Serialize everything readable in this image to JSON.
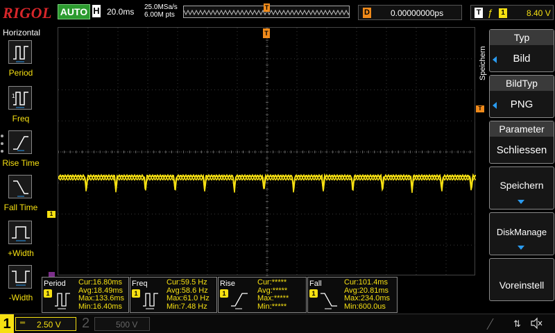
{
  "top": {
    "logo": "RIGOL",
    "auto_label": "AUTO",
    "h_label": "H",
    "timebase": "20.0ms",
    "sample_rate": "25.0MSa/s",
    "mem_depth": "6.00M pts",
    "trigger_pos_glyph": "T",
    "delay_label": "D",
    "delay_value": "0.00000000ps",
    "trigger_label": "T",
    "trigger_edge_glyph": "ƒ",
    "trigger_source": "1",
    "trigger_level": "8.40 V"
  },
  "left_menu": {
    "title": "Horizontal",
    "items": [
      {
        "label": "Period",
        "icon": "period-icon"
      },
      {
        "label": "Freq",
        "icon": "freq-icon"
      },
      {
        "label": "Rise Time",
        "icon": "rise-time-icon"
      },
      {
        "label": "Fall Time",
        "icon": "fall-time-icon"
      },
      {
        "label": "+Width",
        "icon": "pos-width-icon"
      },
      {
        "label": "-Width",
        "icon": "neg-width-icon"
      }
    ]
  },
  "markers": {
    "trigger_top": "T",
    "trigger_level": "T",
    "ch1": "1"
  },
  "right_menu": {
    "vertical_label": "Speichern",
    "type_head": "Typ",
    "type_value": "Bild",
    "imgtype_head": "BildTyp",
    "imgtype_value": "PNG",
    "param_head": "Parameter",
    "param_value": "Schliessen",
    "save_label": "Speichern",
    "disk_label": "DiskManage",
    "preset_label": "Voreinstell"
  },
  "measurements": [
    {
      "name": "Period",
      "ch": "1",
      "cur": "Cur:16.80ms",
      "avg": "Avg:18.49ms",
      "max": "Max:133.6ms",
      "min": "Min:16.40ms"
    },
    {
      "name": "Freq",
      "ch": "1",
      "cur": "Cur:59.5 Hz",
      "avg": "Avg:58.6 Hz",
      "max": "Max:61.0 Hz",
      "min": "Min:7.48 Hz"
    },
    {
      "name": "Rise",
      "ch": "1",
      "cur": "Cur:*****",
      "avg": "Avg:*****",
      "max": "Max:*****",
      "min": "Min:*****"
    },
    {
      "name": "Fall",
      "ch": "1",
      "cur": "Cur:101.4ms",
      "avg": "Avg:20.81ms",
      "max": "Max:234.0ms",
      "min": "Min:600.0us"
    }
  ],
  "bottom": {
    "ch1_num": "1",
    "ch1_coupling": "═",
    "ch1_scale": "2.50 V",
    "ch2_num": "2",
    "ch2_scale": "500 V",
    "usb_glyph": "⇅"
  },
  "colors": {
    "ch1": "#f6e012",
    "trigger": "#f08a1a",
    "brand": "#d8262a",
    "auto": "#2c9b2f",
    "accent": "#2a9bf0"
  }
}
